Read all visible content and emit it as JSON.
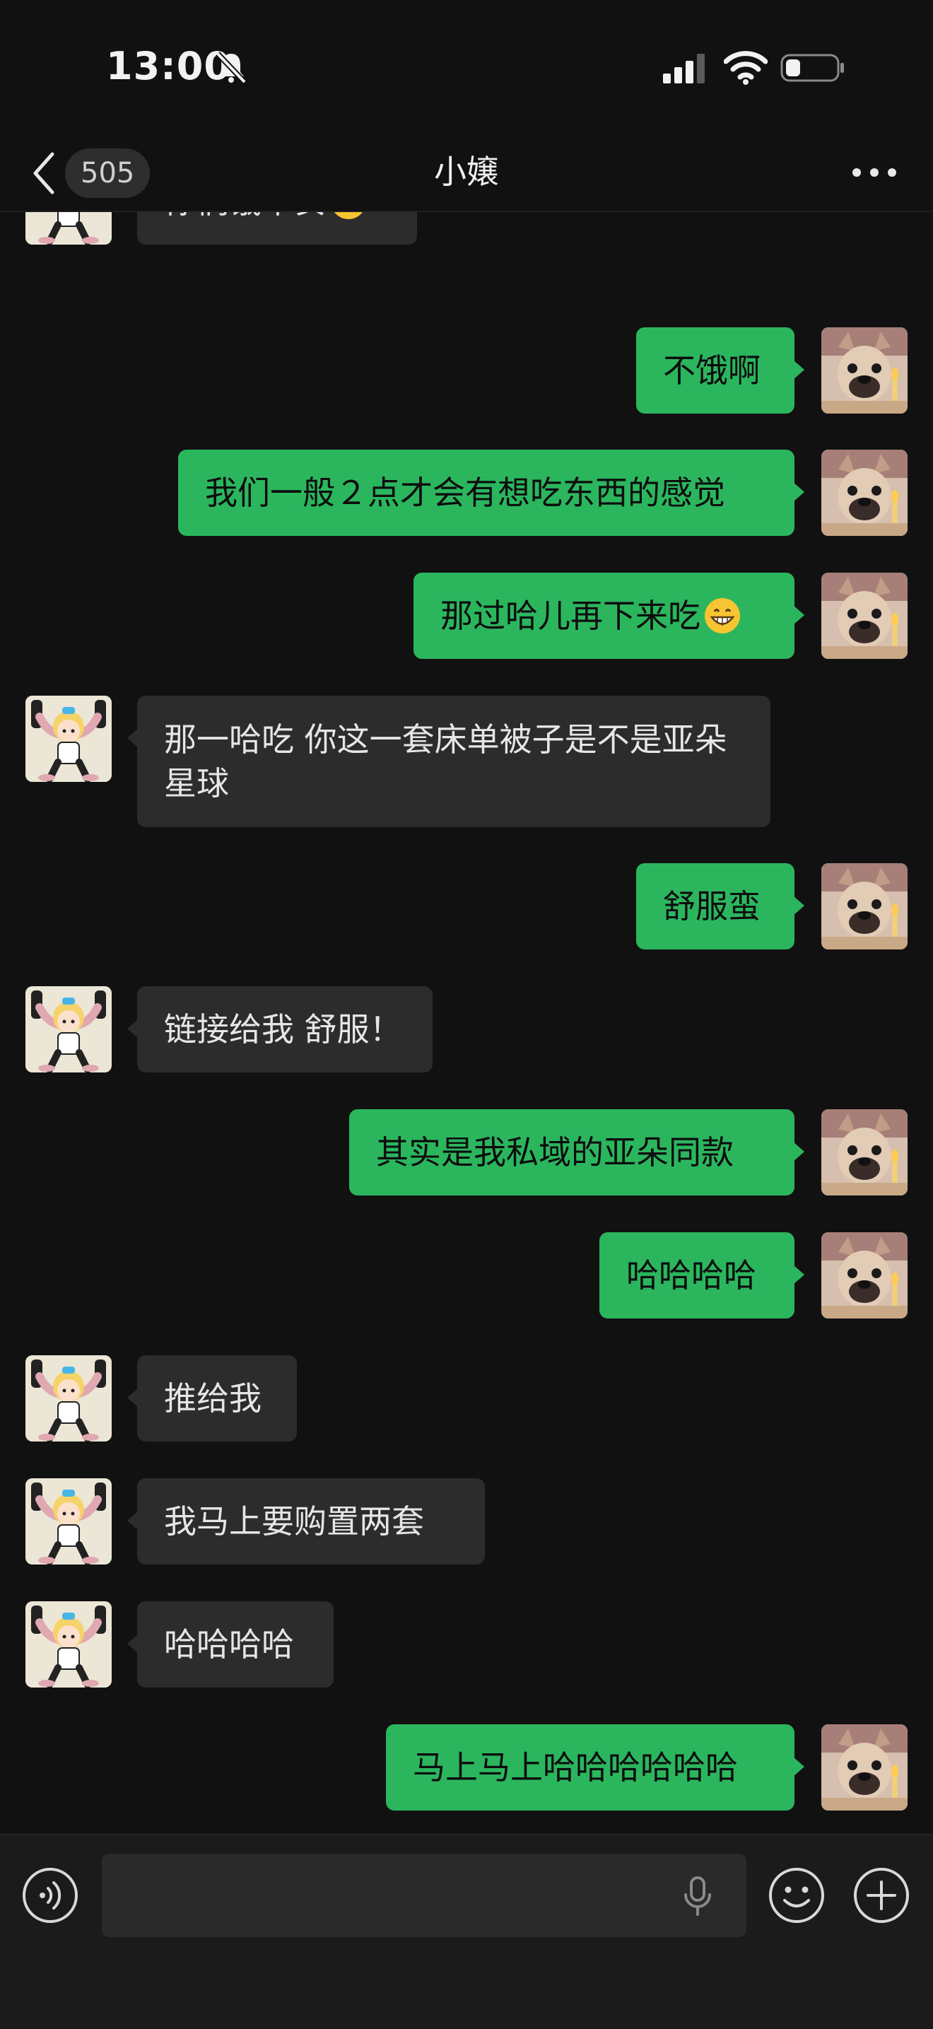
{
  "status_bar": {
    "time": "13:00",
    "icons": [
      "bell-slash-icon",
      "cellular-signal-icon",
      "wifi-icon",
      "battery-icon"
    ]
  },
  "header": {
    "back_icon": "chevron-left-icon",
    "unread_count": "505",
    "title": "小嬢",
    "more_icon": "ellipsis-icon"
  },
  "messages": [
    {
      "side": "in",
      "text": "你们饿不安",
      "emoji": "confused-face-emoji"
    },
    {
      "side": "out",
      "text": "不饿啊"
    },
    {
      "side": "out",
      "text": "我们一般２点才会有想吃东西的感觉"
    },
    {
      "side": "out",
      "text": "那过哈儿再下来吃",
      "emoji": "grinning-face-emoji"
    },
    {
      "side": "in",
      "text": "那一哈吃 你这一套床单被子是不是亚朵星球"
    },
    {
      "side": "out",
      "text": "舒服蛮"
    },
    {
      "side": "in",
      "text": "链接给我 舒服！"
    },
    {
      "side": "out",
      "text": "其实是我私域的亚朵同款"
    },
    {
      "side": "out",
      "text": "哈哈哈哈"
    },
    {
      "side": "in",
      "text": "推给我"
    },
    {
      "side": "in",
      "text": "我马上要购置两套"
    },
    {
      "side": "in",
      "text": "哈哈哈哈"
    },
    {
      "side": "out",
      "text": "马上马上哈哈哈哈哈哈"
    }
  ],
  "input_bar": {
    "voice_icon": "voice-mode-icon",
    "message_value": "",
    "mic_icon": "microphone-icon",
    "emoji_icon": "emoji-smile-icon",
    "plus_icon": "plus-circle-icon"
  },
  "colors": {
    "background": "#111111",
    "outgoing_bubble": "#2bb65e",
    "incoming_bubble": "#2c2c2c",
    "accent": "#2bb65e"
  }
}
